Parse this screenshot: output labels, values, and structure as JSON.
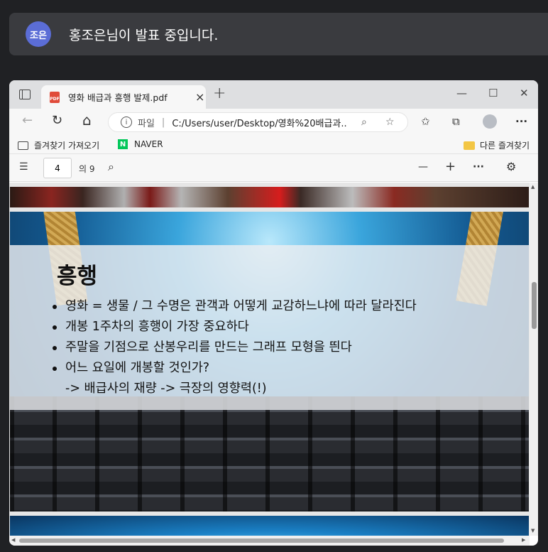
{
  "presenter": {
    "initials": "조은",
    "message": "홍조은님이 발표 중입니다.",
    "avatar_color": "#5b6dd6"
  },
  "browser": {
    "tab_title": "영화 배급과 흥행 발제.pdf",
    "tab_close": "×",
    "new_tab": "+",
    "window_controls": [
      "—",
      "☐",
      "✕"
    ],
    "address": {
      "label": "파일",
      "separator": "|",
      "url": "C:/Users/user/Desktop/영화%20배급과..."
    },
    "bookmarks": {
      "import": "즐겨찾기 가져오기",
      "naver": "NAVER",
      "naver_icon": "N",
      "other": "다른 즐겨찾기"
    },
    "icons": {
      "back": "←",
      "refresh": "↻",
      "home": "⌂",
      "info": "i",
      "zoom": "⌕",
      "star_add": "☆",
      "favorites": "✩",
      "collections": "⧉",
      "more": "···",
      "pdf_badge": "PDF"
    }
  },
  "pdf_toolbar": {
    "current_page": "4",
    "page_count": "의 9",
    "contents_icon": "☰",
    "search_icon": "⌕",
    "zoom_out": "—",
    "zoom_in": "+",
    "more": "···",
    "settings_icon": "⚙"
  },
  "slide": {
    "title": "흥행",
    "bullets": [
      "영화 = 생물 / 그 수명은 관객과 어떻게 교감하느냐에 따라 달라진다",
      "개봉 1주차의 흥행이 가장 중요하다",
      "주말을 기점으로 산봉우리를 만드는 그래프 모형을 띈다",
      "어느 요일에 개봉할 것인가?"
    ],
    "sub_line": "-> 배급사의 재량 -> 극장의 영향력(!)"
  }
}
